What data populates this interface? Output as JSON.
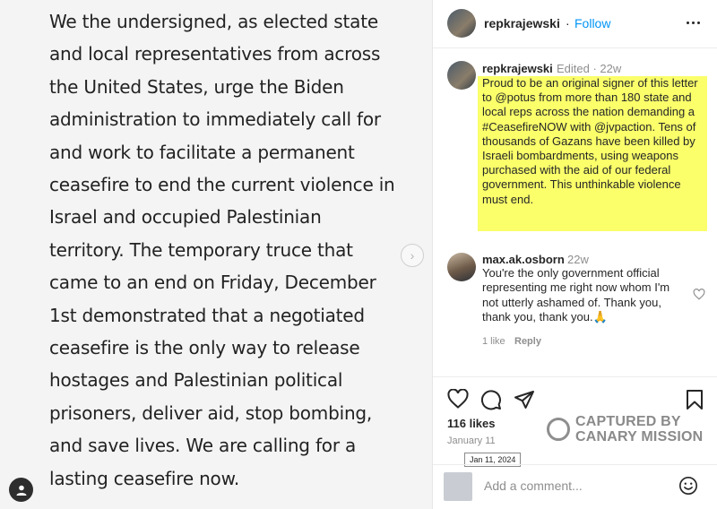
{
  "post_image": {
    "letter_text": "We the undersigned, as elected state and local representatives from across the United States, urge the Biden administration to immediately call for and work to facilitate a permanent ceasefire to end the current violence in Israel and occupied Palestinian territory. The temporary truce that came to an end on Friday, December 1st demonstrated that a negotiated ceasefire is the only way to release hostages and Palestinian political prisoners, deliver aid, stop bombing, and save lives. We are calling for a lasting ceasefire now."
  },
  "header": {
    "username": "repkrajewski",
    "separator": "·",
    "follow_label": "Follow"
  },
  "caption": {
    "username": "repkrajewski",
    "meta": "Edited · 22w",
    "text": "Proud to be an original signer of this letter to @potus from more than 180 state and local reps across the nation demanding a #CeasefireNOW with @jvpaction. Tens of thousands of Gazans have been killed by Israeli bombardments, using weapons purchased with the aid of our federal government. This unthinkable violence must end.",
    "highlight_color": "#faff6a"
  },
  "comment": {
    "username": "max.ak.osborn",
    "time": "22w",
    "text": "You're the only government official representing me right now whom I'm not utterly ashamed of. Thank you, thank you, thank you.🙏",
    "likes": "1 like",
    "reply_label": "Reply"
  },
  "post": {
    "likes_count": "116 likes",
    "date": "January 11",
    "date_tooltip": "Jan 11, 2024"
  },
  "watermark": {
    "line1": "CAPTURED BY",
    "line2": "CANARY MISSION"
  },
  "comment_bar": {
    "placeholder": "Add a comment..."
  },
  "colors": {
    "link_blue": "#0095f6",
    "muted_gray": "#8e8e8e"
  }
}
